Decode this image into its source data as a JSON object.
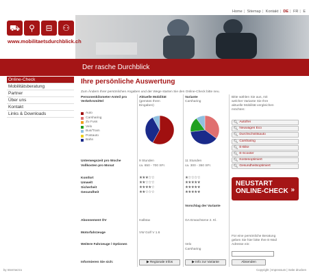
{
  "topnav": {
    "home": "Home",
    "sitemap": "Sitemap",
    "kontakt": "Kontakt",
    "lang_de": "DE",
    "lang_fr": "FR",
    "lang_en": "E"
  },
  "logo": {
    "text": "www.mobilitaetsdurchblick.ch",
    "icons": [
      "car-icon",
      "bike-icon",
      "tram-icon",
      "scooter-icon"
    ]
  },
  "banner": {
    "title": "Der rasche Durchblick"
  },
  "sidebar": {
    "items": [
      {
        "label": "Online-Check",
        "active": true
      },
      {
        "label": "Mobilitätsberatung",
        "active": false
      },
      {
        "label": "Partner",
        "active": false
      },
      {
        "label": "Über uns",
        "active": false
      },
      {
        "label": "Kontakt",
        "active": false
      },
      {
        "label": "Links & Downloads",
        "active": false
      }
    ]
  },
  "main": {
    "title": "Ihre persönliche Auswertung",
    "intro": "Zum Ändern Ihrer persönlichen Angaben und der Wege starten Sie den Online-Check bitte neu."
  },
  "columns": {
    "label_head1": "Personenkilometer-Anteil pro",
    "label_head2": "Verkehrsmittel",
    "current_head": "Aktuelle Mobilität",
    "current_sub1": "(gemäss Ihren",
    "current_sub2": "Eingaben)",
    "variant_head": "Variante",
    "variant_sub": "Carsharing",
    "right_intro": [
      "Bitte wählen Sie aus, mit",
      "welcher Variante Sie Ihre",
      "aktuelle Mobilität vergleichen",
      "möchten:"
    ]
  },
  "legend": [
    {
      "label": "Auto",
      "color": "#a01010"
    },
    {
      "label": "Carsharing",
      "color": "#e07070"
    },
    {
      "label": "Zu Fuss",
      "color": "#f0a020"
    },
    {
      "label": "Velo",
      "color": "#20a020"
    },
    {
      "label": "Bus/Tram",
      "color": "#90c0e0"
    },
    {
      "label": "Postauto",
      "color": "#f0d020"
    },
    {
      "label": "Bahn",
      "color": "#1a2a8a"
    }
  ],
  "chart_data": [
    {
      "type": "pie",
      "title": "Aktuelle Mobilität",
      "categories": [
        "Auto",
        "Bahn",
        "Bus/Tram"
      ],
      "values": [
        58,
        34,
        8
      ]
    },
    {
      "type": "pie",
      "title": "Variante Carsharing",
      "categories": [
        "Carsharing",
        "Bahn",
        "Velo",
        "Bus/Tram"
      ],
      "values": [
        35,
        38,
        17,
        10
      ]
    }
  ],
  "rows": {
    "time_label": "Unterwegszeit pro Woche",
    "cost_label": "Vollkosten pro Monat",
    "current_time": "9 Stunden",
    "current_cost": "ca. 650 - 700 SFr.",
    "variant_time": "11 Stunden",
    "variant_cost": "ca. 300 - 350 SFr.",
    "ratings": [
      {
        "label": "Komfort",
        "current": "★★★☆☆",
        "variant": "★☆☆☆☆"
      },
      {
        "label": "Umwelt",
        "current": "★★☆☆☆",
        "variant": "★★★★★"
      },
      {
        "label": "Sicherheit",
        "current": "★★★★☆",
        "variant": "★★★★★"
      },
      {
        "label": "Gesundheit",
        "current": "★★☆☆☆",
        "variant": "★★★★★"
      }
    ],
    "vorschlag": "Vorschlag der Variante",
    "abo_label": "Abonnement ÖV",
    "abo_current": "Halbtax",
    "abo_variant": "GA Erwachsene 2. Kl.",
    "motor_label": "Motorfahrzeuge",
    "motor_current": "VW Golf V 1.6",
    "weitere_label": "Weitere Fahrzeuge / Optionen",
    "weitere_variant1": "Velo",
    "weitere_variant2": "Carsharing",
    "info_label": "Informieren Sie sich:",
    "btn_regional": "Regionale Infos",
    "btn_variante": "Info zur Variante"
  },
  "variants": [
    "Autofrei",
    "Neuwagen Eco",
    "Durchschnittsauto",
    "Carsharing",
    "E-Bike",
    "E-Scooter",
    "Kostenoptimiert",
    "Gesundheitsoptimiert"
  ],
  "restart": {
    "line1": "NEUSTART",
    "line2": "ONLINE-CHECK",
    "arrow": "»"
  },
  "beratung": {
    "text": [
      "Für eine persönliche Beratung",
      "geben Sie hier bitte Ihre E-Mail",
      "Adresse ein:"
    ],
    "email_value": "",
    "submit": "Absenden"
  },
  "footer": {
    "left": "by Intermezzo",
    "right": "Copyright | Impressum | Seite drucken"
  }
}
